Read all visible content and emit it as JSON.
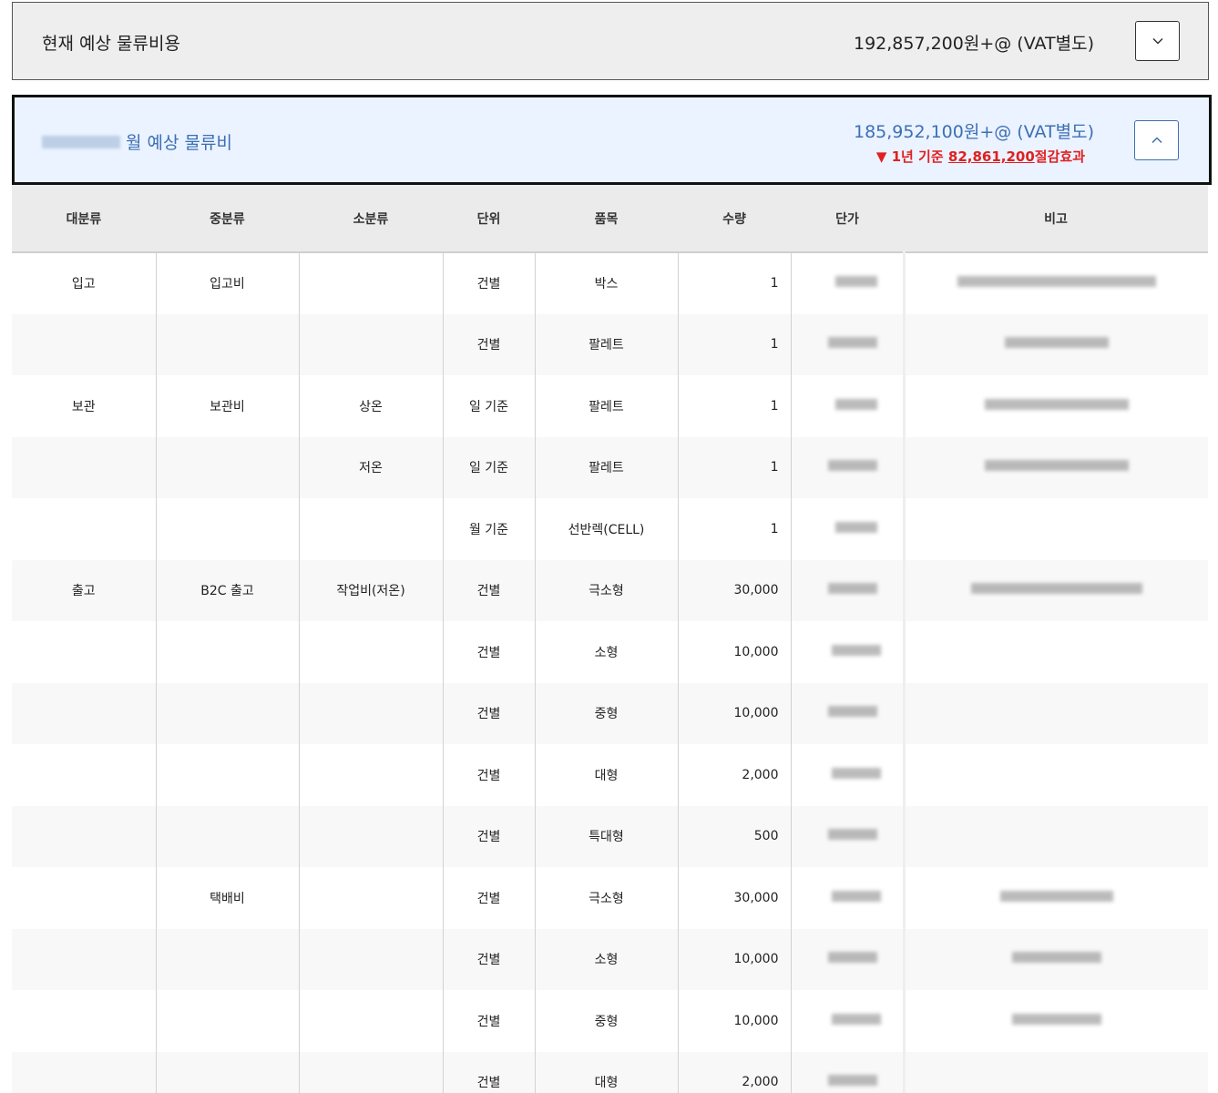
{
  "current": {
    "title": "현재 예상 물류비용",
    "amount": "192,857,200원+@ (VAT별도)",
    "toggle_icon": "chevron-down-icon"
  },
  "planned": {
    "title": "월 예상 물류비",
    "amount": "185,952,100원+@ (VAT별도)",
    "saving_prefix": "▼ 1년 기준 ",
    "saving_amount": "82,861,200",
    "saving_suffix": "절감효과",
    "toggle_icon": "chevron-up-icon"
  },
  "table": {
    "headers": [
      "대분류",
      "중분류",
      "소분류",
      "단위",
      "품목",
      "수량",
      "단가",
      "비고"
    ],
    "rows": [
      {
        "major": "입고",
        "middle": "입고비",
        "minor": "",
        "unit": "건별",
        "item": "박스",
        "qty": "1"
      },
      {
        "major": "",
        "middle": "",
        "minor": "",
        "unit": "건별",
        "item": "팔레트",
        "qty": "1"
      },
      {
        "major": "보관",
        "middle": "보관비",
        "minor": "상온",
        "unit": "일 기준",
        "item": "팔레트",
        "qty": "1"
      },
      {
        "major": "",
        "middle": "",
        "minor": "저온",
        "unit": "일 기준",
        "item": "팔레트",
        "qty": "1"
      },
      {
        "major": "",
        "middle": "",
        "minor": "",
        "unit": "월 기준",
        "item": "선반렉(CELL)",
        "qty": "1"
      },
      {
        "major": "출고",
        "middle": "B2C 출고",
        "minor": "작업비(저온)",
        "unit": "건별",
        "item": "극소형",
        "qty": "30,000"
      },
      {
        "major": "",
        "middle": "",
        "minor": "",
        "unit": "건별",
        "item": "소형",
        "qty": "10,000"
      },
      {
        "major": "",
        "middle": "",
        "minor": "",
        "unit": "건별",
        "item": "중형",
        "qty": "10,000"
      },
      {
        "major": "",
        "middle": "",
        "minor": "",
        "unit": "건별",
        "item": "대형",
        "qty": "2,000"
      },
      {
        "major": "",
        "middle": "",
        "minor": "",
        "unit": "건별",
        "item": "특대형",
        "qty": "500"
      },
      {
        "major": "",
        "middle": "택배비",
        "minor": "",
        "unit": "건별",
        "item": "극소형",
        "qty": "30,000"
      },
      {
        "major": "",
        "middle": "",
        "minor": "",
        "unit": "건별",
        "item": "소형",
        "qty": "10,000"
      },
      {
        "major": "",
        "middle": "",
        "minor": "",
        "unit": "건별",
        "item": "중형",
        "qty": "10,000"
      },
      {
        "major": "",
        "middle": "",
        "minor": "",
        "unit": "건별",
        "item": "대형",
        "qty": "2,000"
      }
    ]
  }
}
